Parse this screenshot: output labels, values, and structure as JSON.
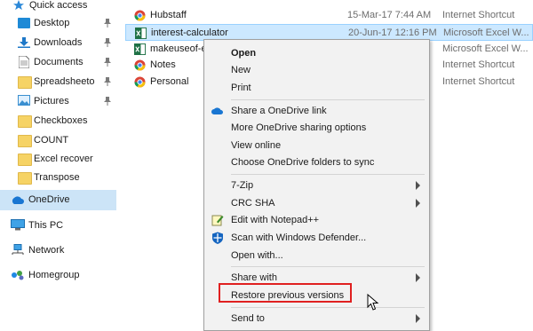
{
  "sidebar": {
    "items": [
      {
        "label": "Quick access",
        "icon": "star-icon",
        "pinned": false
      },
      {
        "label": "Desktop",
        "icon": "desktop-icon",
        "pinned": true
      },
      {
        "label": "Downloads",
        "icon": "download-icon",
        "pinned": true
      },
      {
        "label": "Documents",
        "icon": "documents-icon",
        "pinned": true
      },
      {
        "label": "Spreadsheeto",
        "icon": "folder-icon",
        "pinned": true
      },
      {
        "label": "Pictures",
        "icon": "pictures-icon",
        "pinned": true
      },
      {
        "label": "Checkboxes",
        "icon": "folder-icon",
        "pinned": false
      },
      {
        "label": "COUNT",
        "icon": "folder-icon",
        "pinned": false
      },
      {
        "label": "Excel recover",
        "icon": "folder-icon",
        "pinned": false
      },
      {
        "label": "Transpose",
        "icon": "folder-icon",
        "pinned": false
      },
      {
        "label": "OneDrive",
        "icon": "cloud-icon",
        "selected": true
      },
      {
        "label": "This PC",
        "icon": "computer-icon"
      },
      {
        "label": "Network",
        "icon": "network-icon"
      },
      {
        "label": "Homegroup",
        "icon": "homegroup-icon"
      }
    ]
  },
  "files": [
    {
      "name": "Hubstaff",
      "date": "15-Mar-17 7:44 AM",
      "type": "Internet Shortcut",
      "icon": "chrome-icon"
    },
    {
      "name": "interest-calculator",
      "date": "20-Jun-17 12:16 PM",
      "type": "Microsoft Excel W...",
      "icon": "excel-icon",
      "selected": true
    },
    {
      "name": "makeuseof-e",
      "date": "",
      "type": "Microsoft Excel W...",
      "icon": "excel-icon"
    },
    {
      "name": "Notes",
      "date": "",
      "type": "Internet Shortcut",
      "icon": "chrome-icon"
    },
    {
      "name": "Personal",
      "date": "",
      "type": "Internet Shortcut",
      "icon": "chrome-icon"
    }
  ],
  "context_menu": {
    "open": "Open",
    "new": "New",
    "print": "Print",
    "share_onedrive": "Share a OneDrive link",
    "more_onedrive": "More OneDrive sharing options",
    "view_online": "View online",
    "choose_folders": "Choose OneDrive folders to sync",
    "sevenzip": "7-Zip",
    "crc_sha": "CRC SHA",
    "edit_notepad": "Edit with Notepad++",
    "scan_defender": "Scan with Windows Defender...",
    "open_with": "Open with...",
    "share_with": "Share with",
    "restore_versions": "Restore previous versions",
    "send_to": "Send to"
  },
  "colors": {
    "selection": "#cce4f7",
    "highlight_box": "#e02020",
    "menu_bg": "#f2f2f2"
  }
}
